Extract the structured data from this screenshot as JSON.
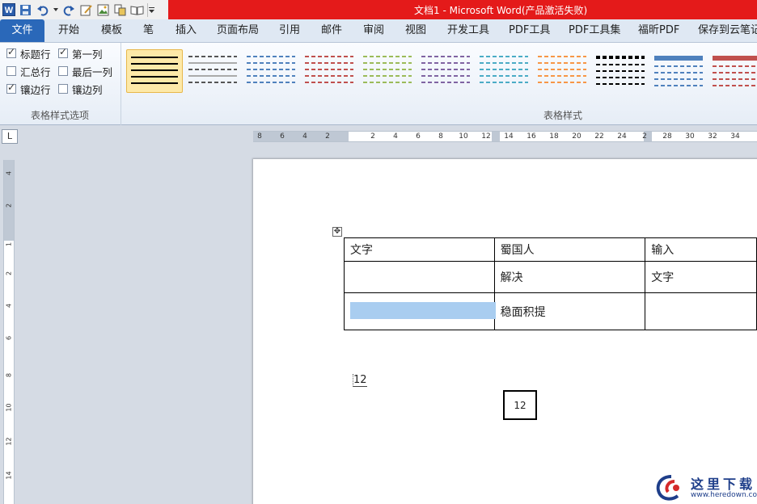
{
  "window": {
    "title": "文档1 - Microsoft Word(产品激活失败)"
  },
  "qat_icons": [
    "word-app-icon",
    "save-icon",
    "undo-icon",
    "undo-dropdown-icon",
    "redo-icon",
    "edit-icon",
    "image-icon",
    "copy-icon",
    "book-icon",
    "customize-qat-icon"
  ],
  "tabs": [
    "文件",
    "开始",
    "模板",
    "笔",
    "插入",
    "页面布局",
    "引用",
    "邮件",
    "审阅",
    "视图",
    "开发工具",
    "PDF工具",
    "PDF工具集",
    "福昕PDF",
    "保存到云笔记"
  ],
  "table_style_options": {
    "group_label": "表格样式选项",
    "items": [
      {
        "label": "标题行",
        "checked": true
      },
      {
        "label": "第一列",
        "checked": true
      },
      {
        "label": "汇总行",
        "checked": false
      },
      {
        "label": "最后一列",
        "checked": false
      },
      {
        "label": "镶边行",
        "checked": true
      },
      {
        "label": "镶边列",
        "checked": false
      }
    ]
  },
  "table_styles": {
    "group_label": "表格样式",
    "colors": [
      "#000000",
      "#555555",
      "#4f81bd",
      "#c0504d",
      "#9bbb59",
      "#8064a2",
      "#4bacc6",
      "#f79646",
      "#000000",
      "#4f81bd",
      "#c0504d"
    ]
  },
  "ruler": {
    "corner": "L",
    "h_ticks": [
      "8",
      "6",
      "4",
      "2",
      "2",
      "4",
      "6",
      "8",
      "10",
      "12",
      "14",
      "16",
      "18",
      "20",
      "22",
      "24",
      "2",
      "28",
      "30",
      "32",
      "34"
    ],
    "v_ticks": [
      "4",
      "2",
      "1",
      "2",
      "4",
      "6",
      "8",
      "10",
      "12",
      "14"
    ]
  },
  "document": {
    "table": [
      [
        "文字",
        "蜀国人",
        "输入"
      ],
      [
        "",
        "解决",
        "文字"
      ],
      [
        "",
        "稳面积提",
        ""
      ]
    ],
    "field_text": "12",
    "box_text": "12"
  },
  "watermark": {
    "brand": "这里下载",
    "url": "www.heredown.com"
  }
}
